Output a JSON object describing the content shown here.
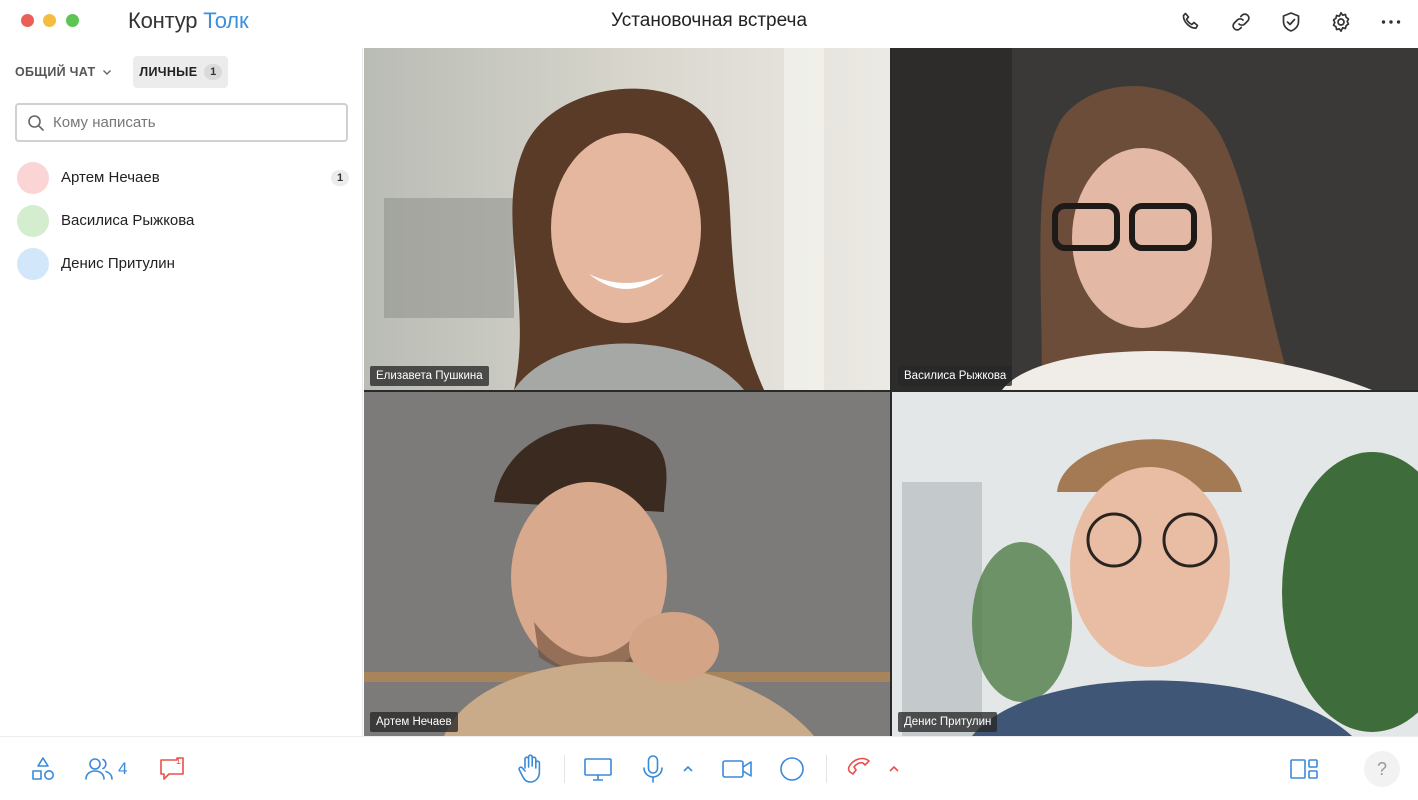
{
  "app": {
    "logo_part1": "Контур",
    "logo_part2": "Толк",
    "meeting_title": "Установочная встреча"
  },
  "sidebar": {
    "tab_general": "ОБЩИЙ ЧАТ",
    "tab_personal": "ЛИЧНЫЕ",
    "tab_personal_badge": "1",
    "search_placeholder": "Кому написать",
    "contacts": [
      {
        "name": "Артем Нечаев",
        "badge": "1",
        "avatar_color": "#fbd5d5"
      },
      {
        "name": "Василиса Рыжкова",
        "badge": "",
        "avatar_color": "#d4edcf"
      },
      {
        "name": "Денис Притулин",
        "badge": "",
        "avatar_color": "#d3e7fb"
      }
    ]
  },
  "participants": [
    {
      "name": "Елизавета Пушкина",
      "active": true
    },
    {
      "name": "Василиса Рыжкова",
      "active": false
    },
    {
      "name": "Артем Нечаев",
      "active": false
    },
    {
      "name": "Денис Притулин",
      "active": true
    }
  ],
  "toolbar": {
    "participants_count": "4",
    "chat_unread": "1"
  },
  "colors": {
    "accent": "#3d8fdc",
    "active_border": "#2f96ea",
    "hangup": "#e8504b"
  },
  "icons": [
    "phone-icon",
    "link-icon",
    "shield-check-icon",
    "gear-icon",
    "more-icon",
    "search-icon",
    "chevron-down-icon",
    "apps-icon",
    "people-icon",
    "chat-icon",
    "raise-hand-icon",
    "screen-share-icon",
    "microphone-icon",
    "camera-icon",
    "record-icon",
    "hangup-icon",
    "layout-icon",
    "help-icon"
  ]
}
